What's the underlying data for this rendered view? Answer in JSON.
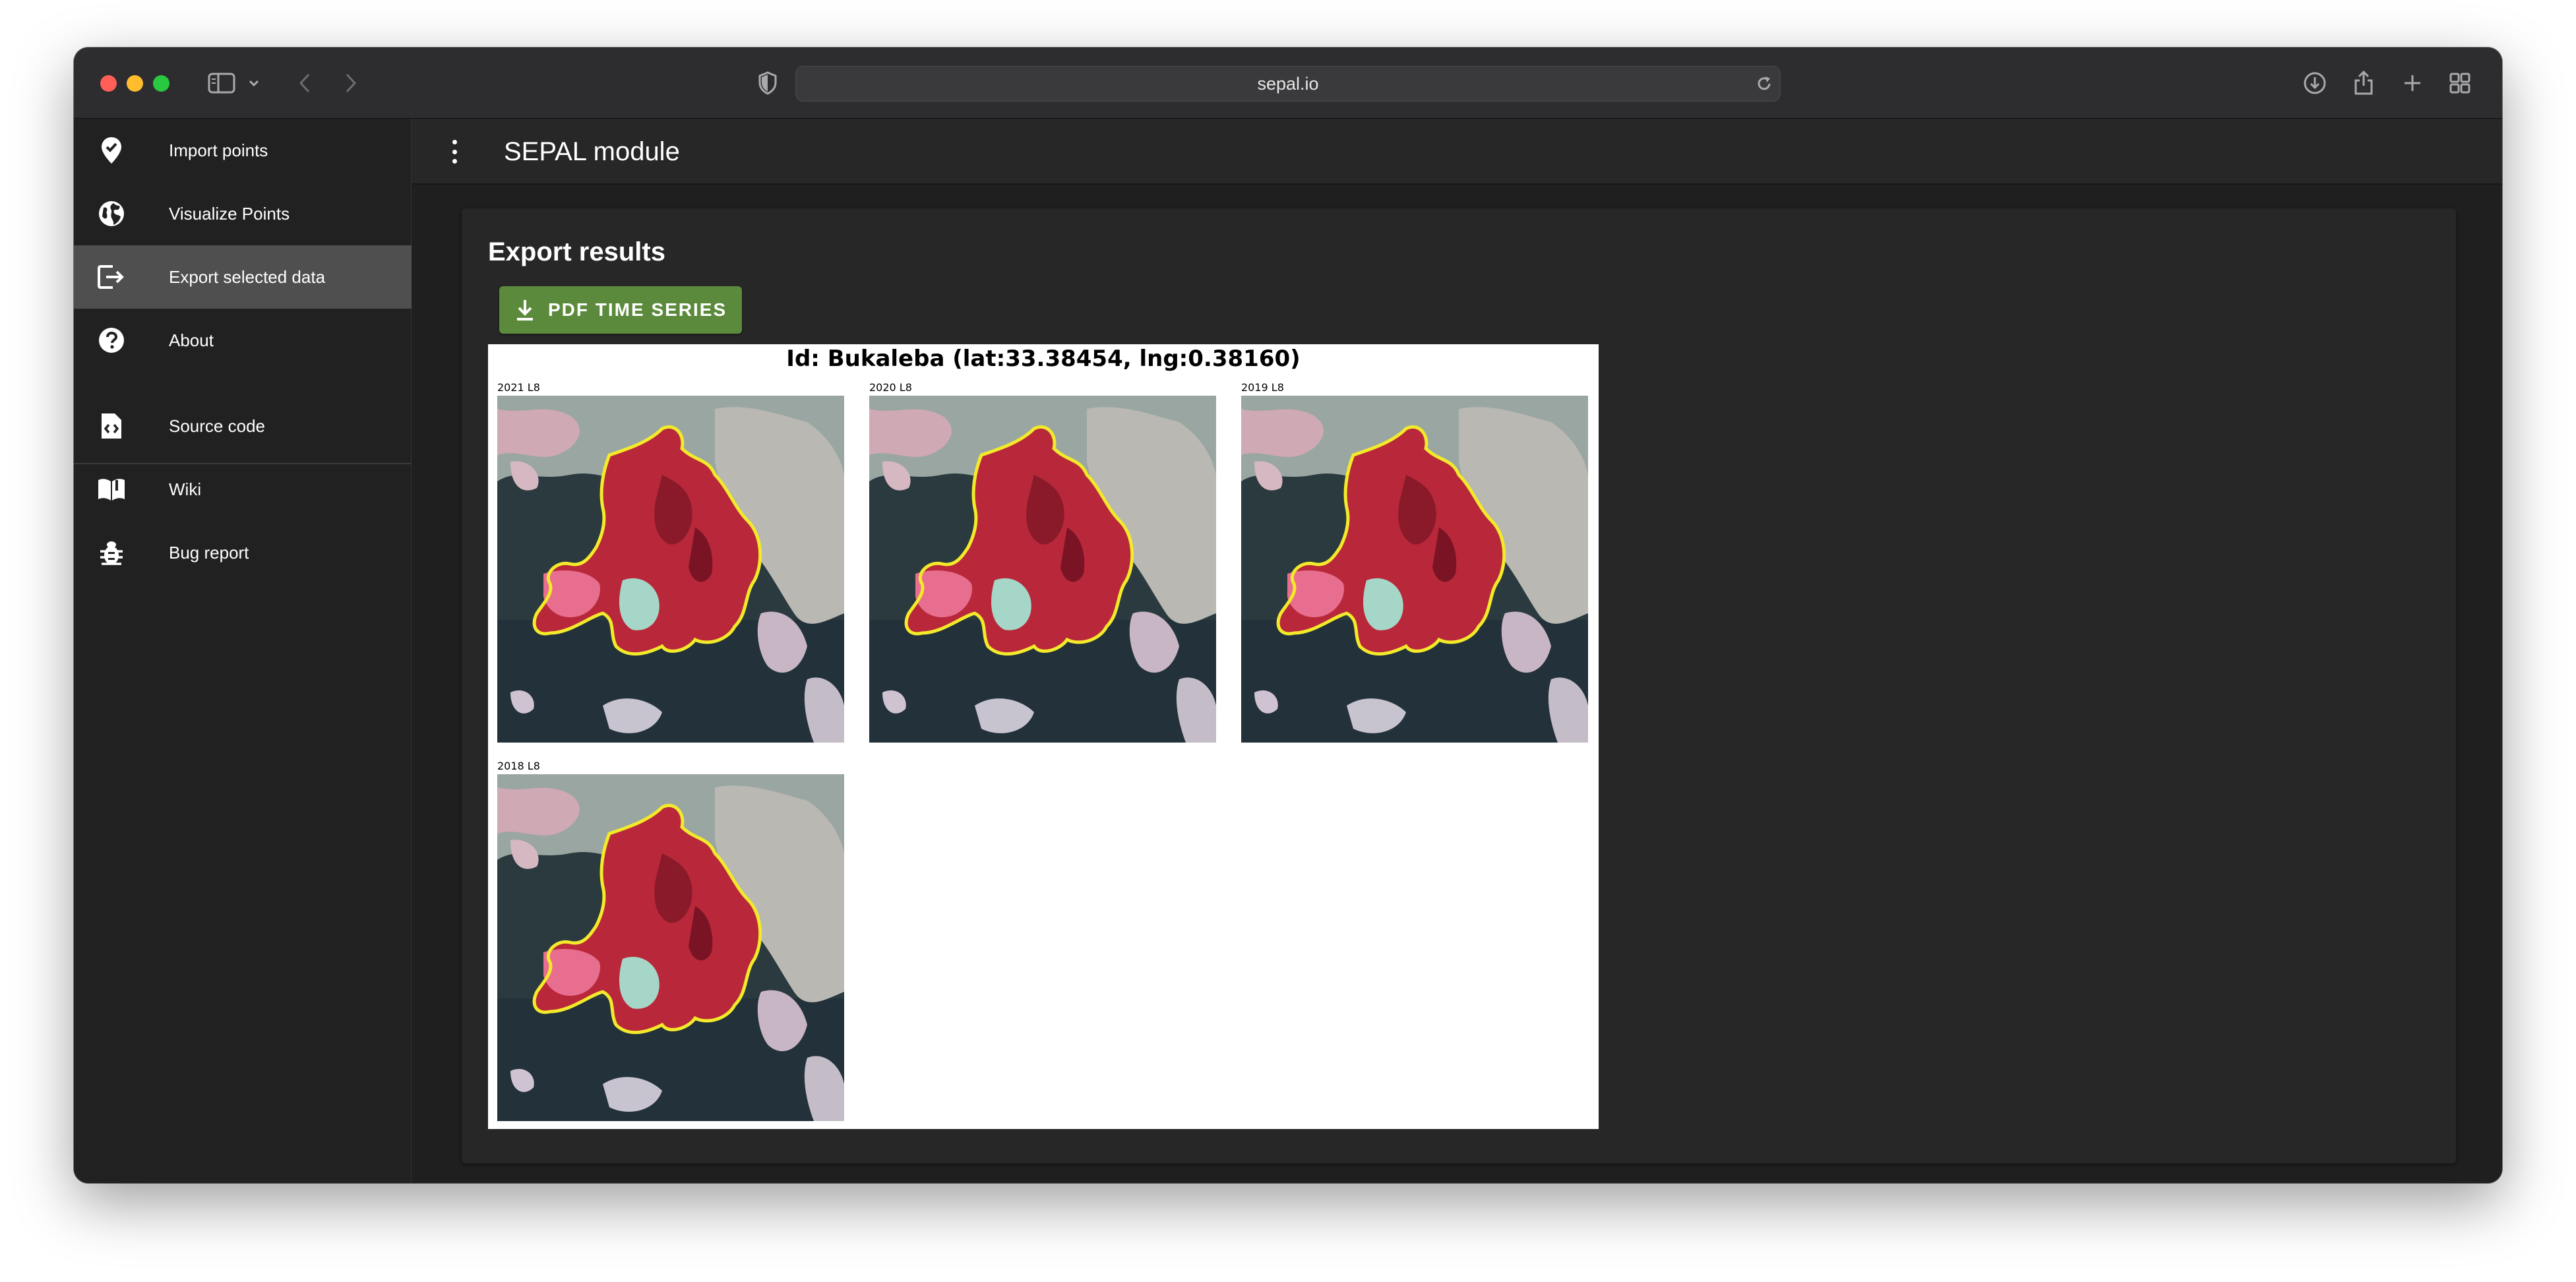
{
  "browser": {
    "url": "sepal.io"
  },
  "sidebar": {
    "items": [
      {
        "label": "Import points",
        "icon": "map-marker-check-icon"
      },
      {
        "label": "Visualize Points",
        "icon": "globe-icon"
      },
      {
        "label": "Export selected data",
        "icon": "export-icon",
        "active": true
      },
      {
        "label": "About",
        "icon": "help-circle-icon"
      },
      {
        "label": "Source code",
        "icon": "file-code-icon"
      },
      {
        "label": "Wiki",
        "icon": "book-open-icon"
      },
      {
        "label": "Bug report",
        "icon": "bug-icon"
      }
    ]
  },
  "header": {
    "title": "SEPAL module"
  },
  "main": {
    "title": "Export results",
    "pdf_button_label": "PDF TIME SERIES",
    "report": {
      "title": "Id: Bukaleba (lat:33.38454, lng:0.38160)",
      "thumbnails": [
        {
          "label": "2021 L8"
        },
        {
          "label": "2020 L8"
        },
        {
          "label": "2019 L8"
        },
        {
          "label": "2018 L8"
        }
      ]
    }
  },
  "colors": {
    "sidebar_bg": "#212121",
    "active_item_bg": "#4f4f4f",
    "button_green": "#5c8a3c",
    "boundary_yellow": "#f2ea2a"
  }
}
